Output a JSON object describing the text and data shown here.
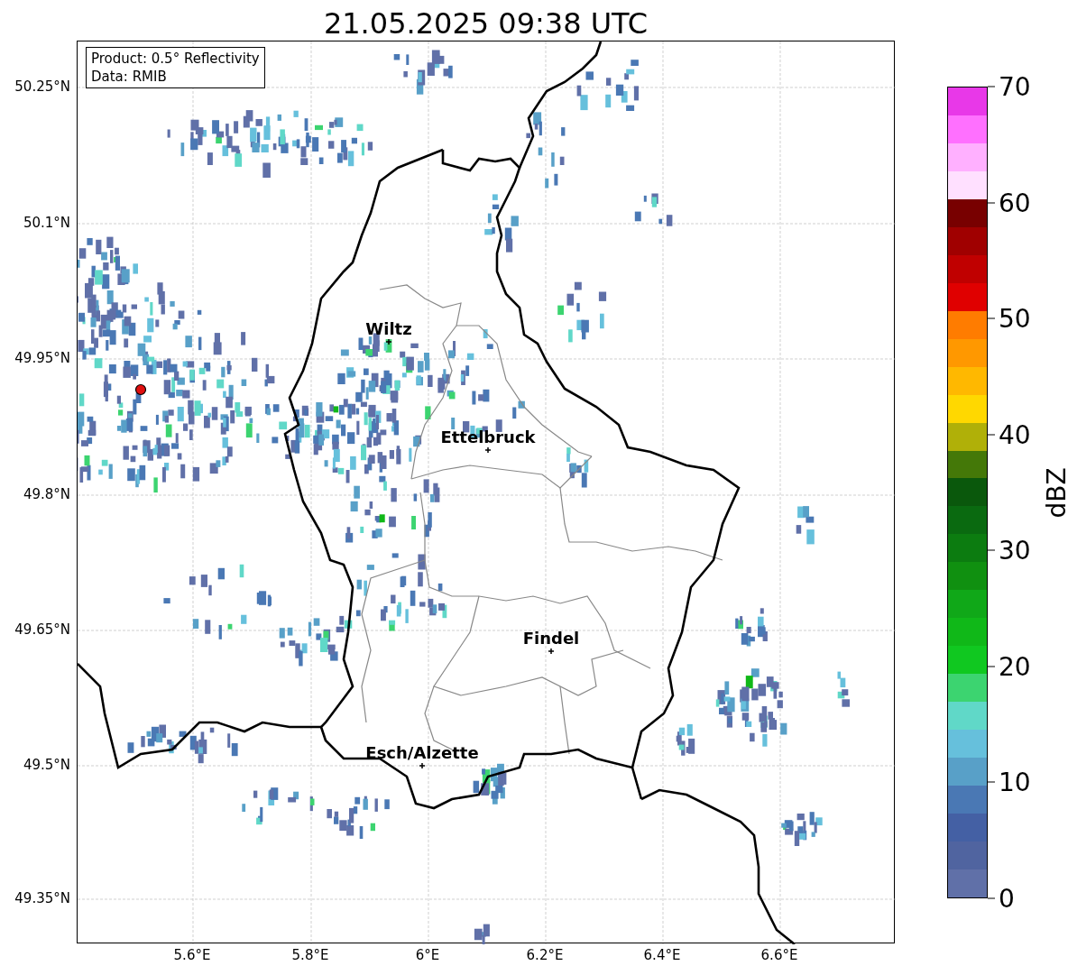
{
  "title": "21.05.2025 09:38 UTC",
  "info_box": [
    "Product: 0.5° Reflectivity",
    "Data: RMIB"
  ],
  "map": {
    "x_ticks": [
      "5.6°E",
      "5.8°E",
      "6°E",
      "6.2°E",
      "6.4°E",
      "6.6°E"
    ],
    "y_ticks": [
      "50.25°N",
      "50.1°N",
      "49.95°N",
      "49.8°N",
      "49.65°N",
      "49.5°N",
      "49.35°N"
    ],
    "cities": [
      {
        "name": "Wiltz"
      },
      {
        "name": "Ettelbruck"
      },
      {
        "name": "Findel"
      },
      {
        "name": "Esch/Alzette"
      }
    ]
  },
  "colorbar": {
    "label": "dBZ",
    "ticks": [
      "70",
      "60",
      "50",
      "40",
      "30",
      "20",
      "10",
      "0"
    ],
    "segments": [
      {
        "color": "#6070a8"
      },
      {
        "color": "#5064a0"
      },
      {
        "color": "#4460a4"
      },
      {
        "color": "#4a78b4"
      },
      {
        "color": "#58a0c8"
      },
      {
        "color": "#66c0dc"
      },
      {
        "color": "#60d8c8"
      },
      {
        "color": "#3cd470"
      },
      {
        "color": "#10c820"
      },
      {
        "color": "#10b818"
      },
      {
        "color": "#10a818"
      },
      {
        "color": "#109010"
      },
      {
        "color": "#0c7c10"
      },
      {
        "color": "#0a6a10"
      },
      {
        "color": "#0a580c"
      },
      {
        "color": "#447808"
      },
      {
        "color": "#b0b008"
      },
      {
        "color": "#ffd800"
      },
      {
        "color": "#ffb800"
      },
      {
        "color": "#ff9800"
      },
      {
        "color": "#ff7c00"
      },
      {
        "color": "#e00000"
      },
      {
        "color": "#c00000"
      },
      {
        "color": "#a00000"
      },
      {
        "color": "#780000"
      },
      {
        "color": "#ffe0ff"
      },
      {
        "color": "#ffb0ff"
      },
      {
        "color": "#ff70ff"
      },
      {
        "color": "#e838e8"
      }
    ]
  }
}
